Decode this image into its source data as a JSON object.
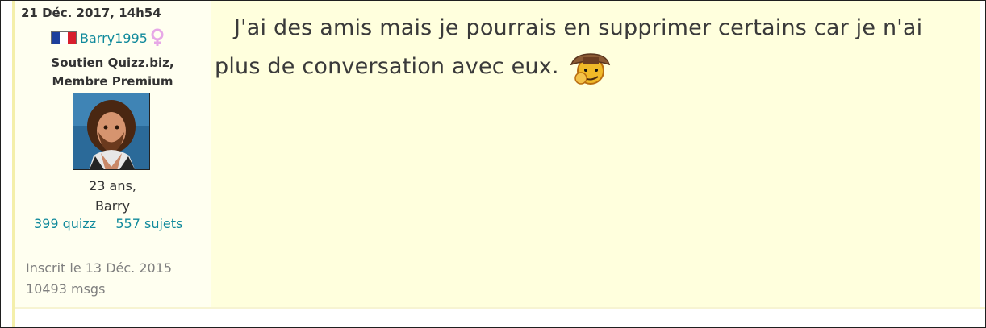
{
  "post": {
    "date": "21 Déc. 2017, 14h54",
    "message": "J'ai des amis mais je pourrais en supprimer certains car je n'ai plus de conversation avec eux."
  },
  "author": {
    "flag": "france-flag",
    "username": "Barry1995",
    "gender_icon": "female-symbol-icon",
    "status_line1": "Soutien Quizz.biz,",
    "status_line2": "Membre Premium",
    "age": "23 ans,",
    "name": "Barry",
    "quizz_count": "399 quizz",
    "topics_count": "557 sujets",
    "joined": "Inscrit le 13 Déc. 2015",
    "messages": "10493 msgs"
  },
  "icons": {
    "smiley": "detective-smiley-icon"
  },
  "colors": {
    "link": "#118a9c",
    "post_background": "#ffffdd",
    "profile_background": "#fffff0",
    "accent_rule": "#f4efaa"
  }
}
